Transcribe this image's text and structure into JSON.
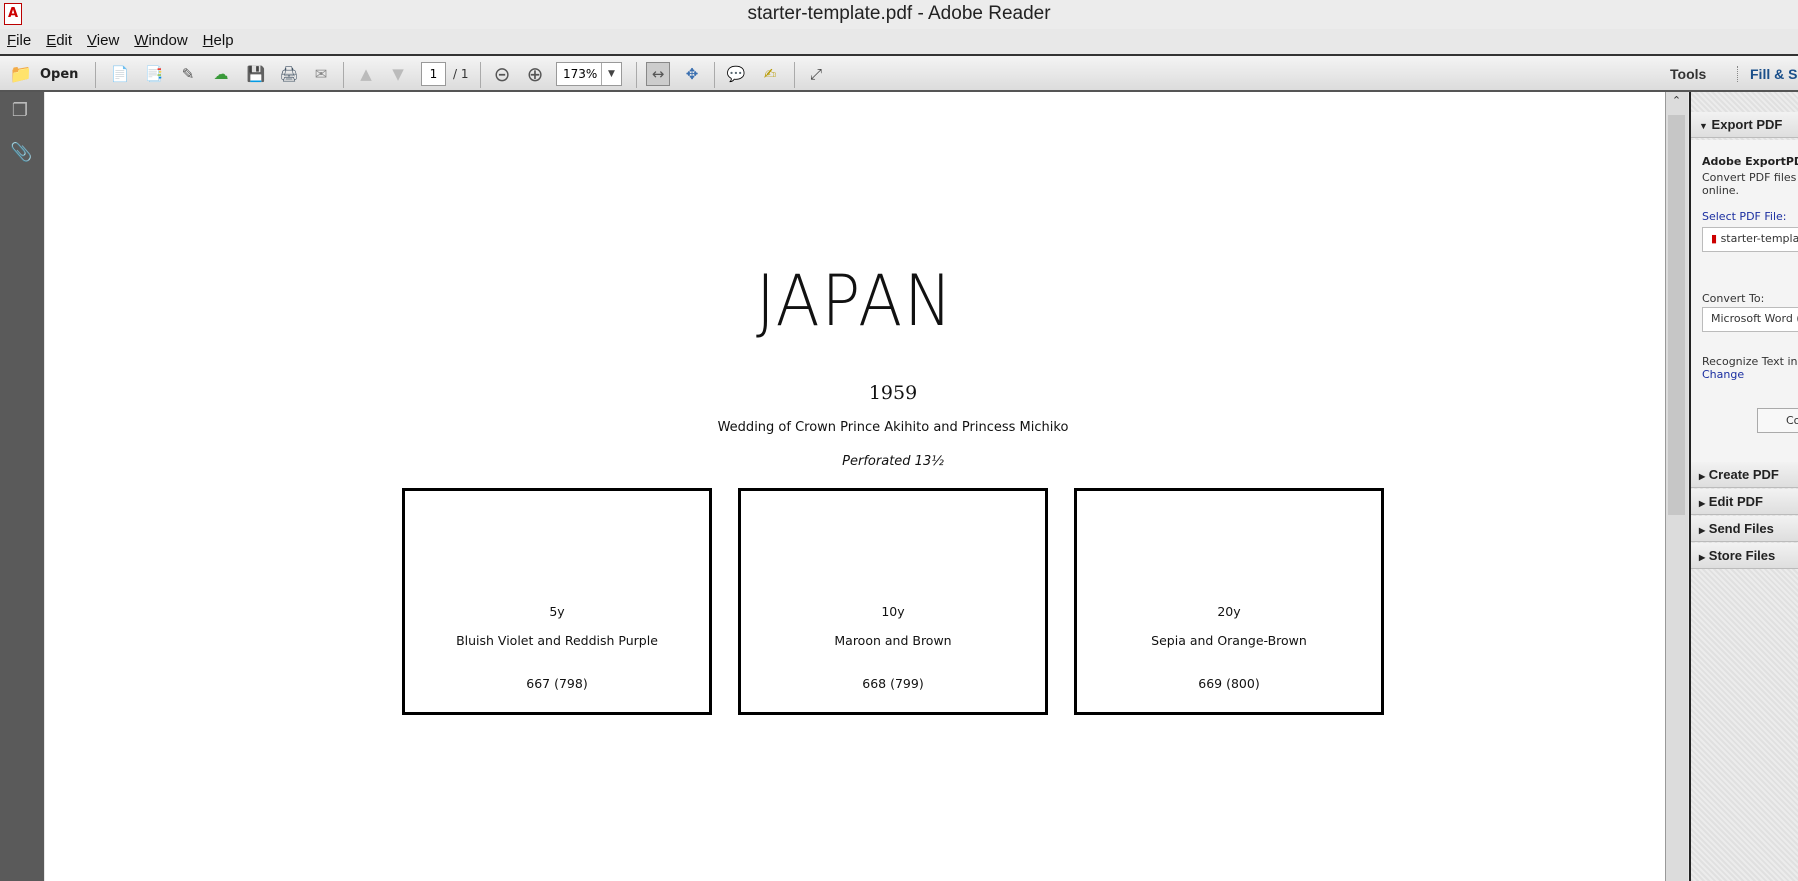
{
  "window": {
    "title": "starter-template.pdf - Adobe Reader"
  },
  "menu": [
    {
      "label": "File",
      "u": "F",
      "rest": "ile"
    },
    {
      "label": "Edit",
      "u": "E",
      "rest": "dit"
    },
    {
      "label": "View",
      "u": "V",
      "rest": "iew"
    },
    {
      "label": "Window",
      "u": "W",
      "rest": "indow"
    },
    {
      "label": "Help",
      "u": "H",
      "rest": "elp"
    }
  ],
  "toolbar": {
    "open_label": "Open",
    "page_current": "1",
    "page_total": "/ 1",
    "zoom": "173%",
    "tools_label": "Tools",
    "fill_sign_label": "Fill & Sign"
  },
  "document": {
    "title": "JAPAN",
    "year": "1959",
    "subtitle": "Wedding of Crown Prince Akihito and Princess Michiko",
    "perforation": "Perforated 13½",
    "stamps": [
      {
        "denomination": "5y",
        "color": "Bluish Violet and Reddish Purple",
        "catalog": "667 (798)"
      },
      {
        "denomination": "10y",
        "color": "Maroon and Brown",
        "catalog": "668 (799)"
      },
      {
        "denomination": "20y",
        "color": "Sepia and Orange-Brown",
        "catalog": "669 (800)"
      }
    ]
  },
  "right_panel": {
    "export_header": "Export PDF",
    "service_title": "Adobe ExportPDF",
    "service_desc_1": "Convert PDF files to",
    "service_desc_2": "online.",
    "select_label": "Select PDF File:",
    "selected_file": "starter-template",
    "convert_to_label": "Convert To:",
    "convert_to_value": "Microsoft Word (",
    "recognize_text": "Recognize Text in E",
    "change_link": "Change",
    "convert_button": "Co",
    "sections": [
      "Create PDF",
      "Edit PDF",
      "Send Files",
      "Store Files"
    ]
  }
}
